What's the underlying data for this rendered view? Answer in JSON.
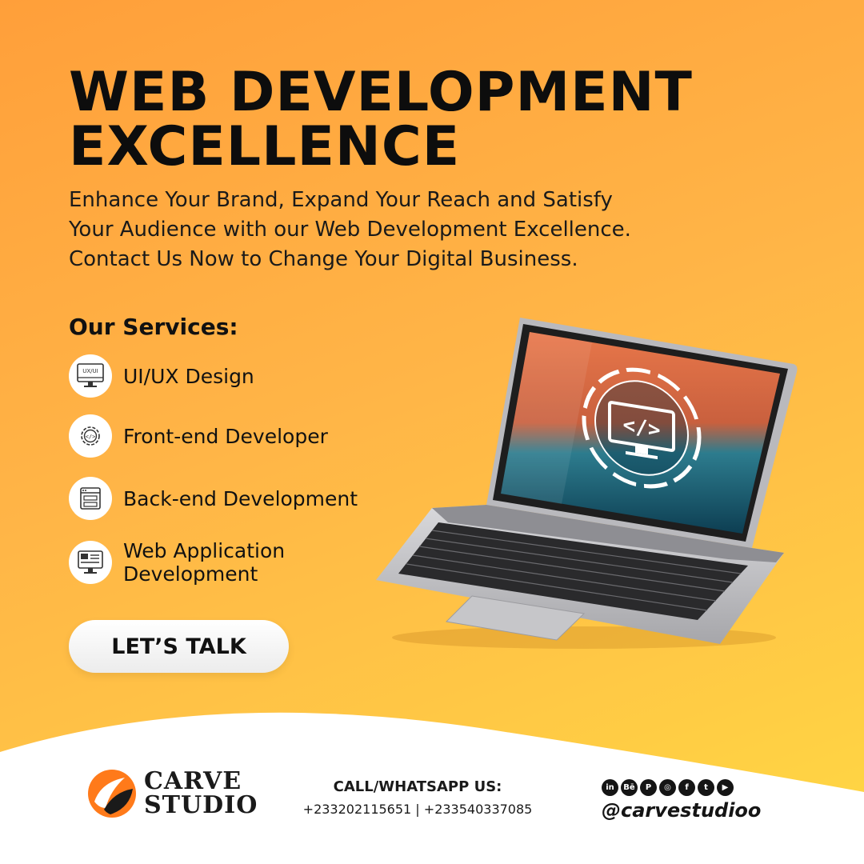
{
  "headline": {
    "line1": "WEB DEVELOPMENT",
    "line2": "EXCELLENCE"
  },
  "subtext": {
    "line1": "Enhance Your Brand, Expand Your Reach and Satisfy",
    "line2": "Your Audience with our Web Development Excellence.",
    "line3": "Contact Us Now to Change Your Digital Business."
  },
  "services": {
    "title": "Our Services:",
    "items": [
      {
        "line1": "UI/UX Design",
        "line2": "",
        "icon": "ui-ux-monitor-icon",
        "icon_text": "UX/UI"
      },
      {
        "line1": "Front-end Developer",
        "line2": "",
        "icon": "gear-code-icon",
        "icon_text": "</>"
      },
      {
        "line1": "Back-end Development",
        "line2": "",
        "icon": "server-browser-icon"
      },
      {
        "line1": "Web Application",
        "line2": "Development",
        "icon": "web-app-monitor-icon"
      }
    ]
  },
  "cta": {
    "label": "LET’S TALK"
  },
  "laptop": {
    "screen_glyph": "</>"
  },
  "footer": {
    "logo": {
      "line1": "CARVE",
      "line2": "STUDIO"
    },
    "contact": {
      "title": "CALL/WHATSAPP US:",
      "phones": "+233202115651 | +233540337085"
    },
    "social": {
      "icons": [
        {
          "name": "linkedin-icon",
          "glyph": "in"
        },
        {
          "name": "behance-icon",
          "glyph": "Bē"
        },
        {
          "name": "pinterest-icon",
          "glyph": "P"
        },
        {
          "name": "instagram-icon",
          "glyph": "◎"
        },
        {
          "name": "facebook-icon",
          "glyph": "f"
        },
        {
          "name": "twitter-icon",
          "glyph": "t"
        },
        {
          "name": "youtube-icon",
          "glyph": "▶"
        }
      ],
      "handle": "@carvestudioo"
    }
  },
  "colors": {
    "orange": "#ff9f3a",
    "yellow": "#ffd843",
    "text": "#111111",
    "white": "#ffffff"
  }
}
